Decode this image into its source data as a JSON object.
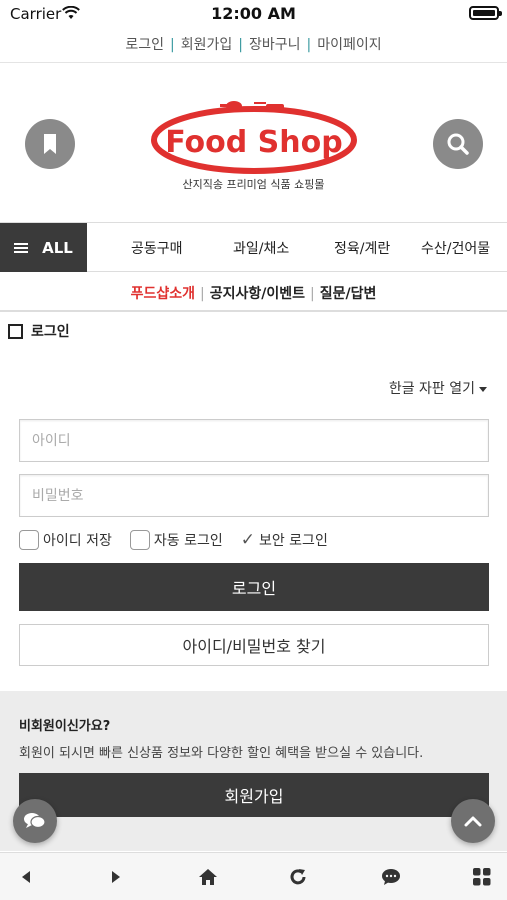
{
  "status": {
    "carrier": "Carrier",
    "time": "12:00 AM"
  },
  "top_links": [
    "로그인",
    "회원가입",
    "장바구니",
    "마이페이지"
  ],
  "logo": {
    "text": "Food Shop",
    "tagline": "산지직송 프리미엄 식품 쇼핑몰"
  },
  "nav": {
    "all_label": "ALL",
    "categories": [
      "공동구매",
      "과일/채소",
      "정육/계란",
      "수산/건어물"
    ]
  },
  "subnav": {
    "items": [
      "푸드샵소개",
      "공지사항/이벤트",
      "질문/답변"
    ],
    "active": "푸드샵소개"
  },
  "section_title": "로그인",
  "keyboard_toggle": "한글 자판 열기",
  "login": {
    "id_placeholder": "아이디",
    "pw_placeholder": "비밀번호",
    "save_id": "아이디 저장",
    "auto_login": "자동 로그인",
    "secure_login": "보안 로그인",
    "login_button": "로그인",
    "find_button": "아이디/비밀번호 찾기"
  },
  "guest": {
    "question": "비회원이신가요?",
    "description": "회원이 되시면 빠른 신상품 정보와 다양한 할인 혜택을 받으실 수 있습니다.",
    "join_button": "회원가입"
  },
  "colors": {
    "brand_red": "#e0312f",
    "dark": "#3a3a3a",
    "gray_button": "#8a8a8a"
  },
  "icons": {
    "toolbar": [
      "back-icon",
      "forward-icon",
      "home-icon",
      "refresh-icon",
      "chat-icon",
      "grid-icon"
    ],
    "header": [
      "bookmark-icon",
      "search-icon"
    ]
  }
}
